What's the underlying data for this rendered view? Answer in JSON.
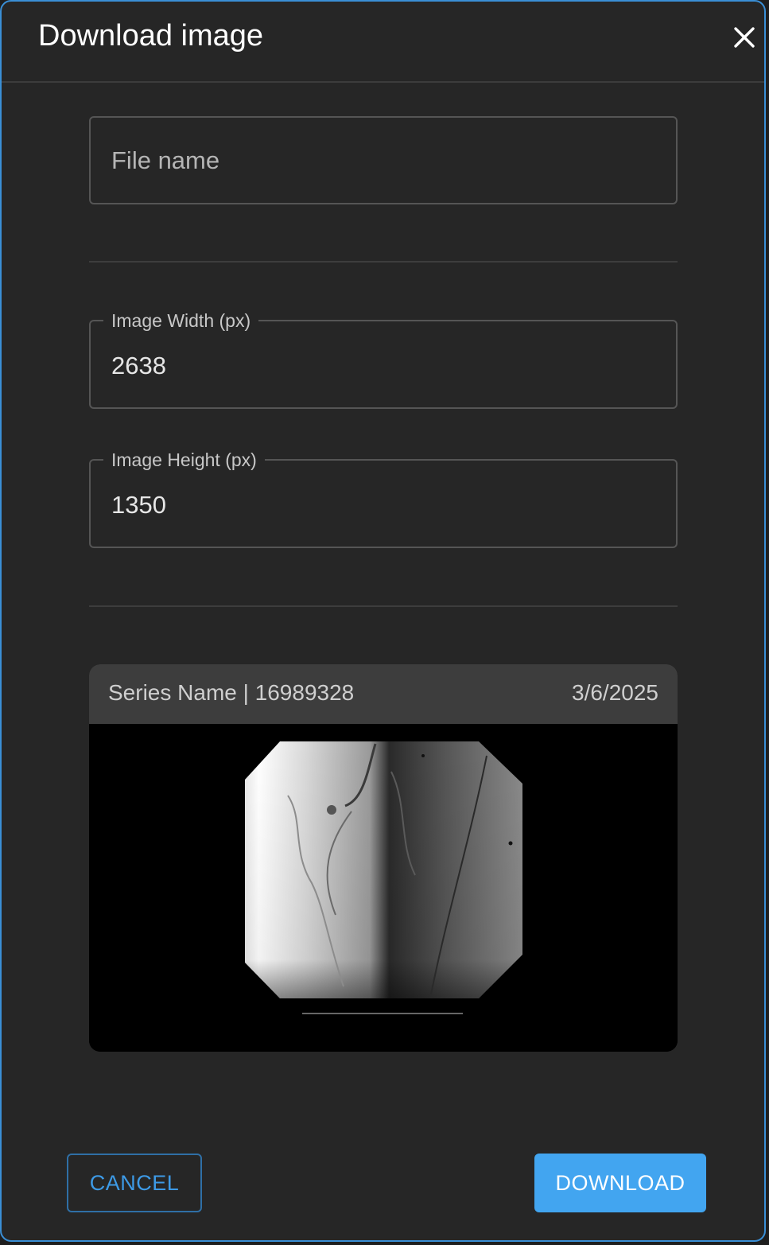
{
  "dialog": {
    "title": "Download image"
  },
  "form": {
    "file_name_placeholder": "File name",
    "file_name_value": "",
    "width_label": "Image Width (px)",
    "width_value": "2638",
    "height_label": "Image Height (px)",
    "height_value": "1350"
  },
  "preview": {
    "series_name": "Series Name | 16989328",
    "date": "3/6/2025"
  },
  "actions": {
    "cancel_label": "CANCEL",
    "download_label": "DOWNLOAD"
  },
  "colors": {
    "accent": "#42a5f0",
    "background": "#262626",
    "border_highlight": "#3a8fd6"
  }
}
